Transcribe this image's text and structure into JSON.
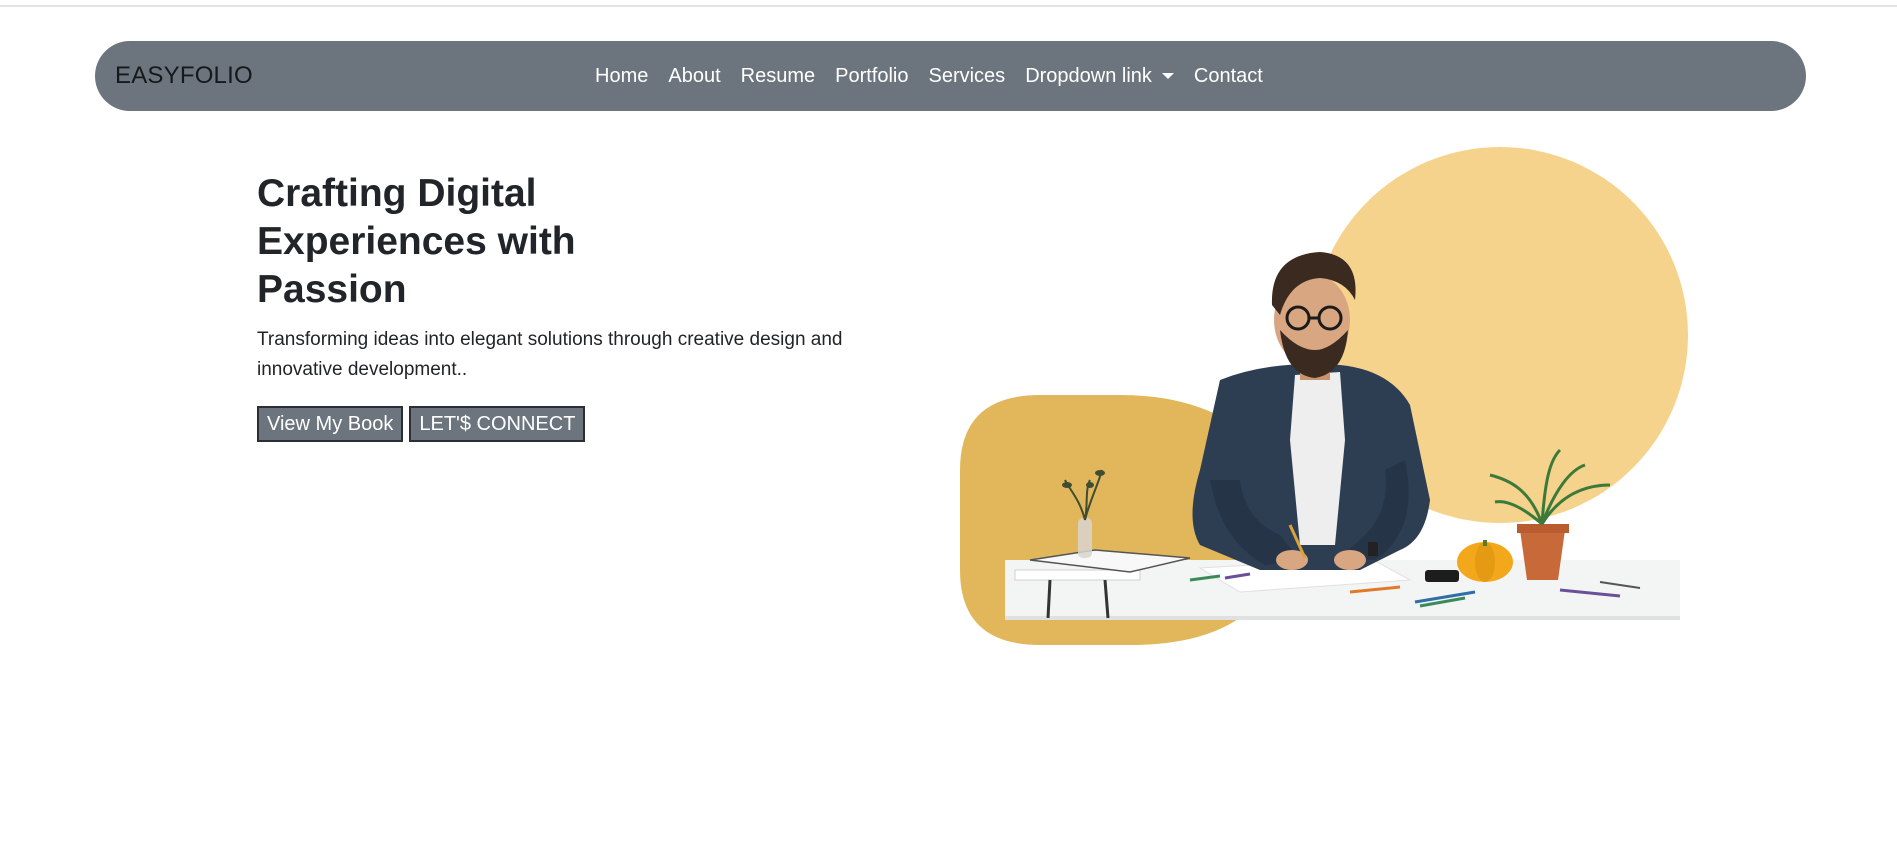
{
  "navbar": {
    "brand": "EASYFOLIO",
    "links": [
      {
        "label": "Home"
      },
      {
        "label": "About"
      },
      {
        "label": "Resume"
      },
      {
        "label": "Portfolio"
      },
      {
        "label": "Services"
      },
      {
        "label": "Dropdown link",
        "has_caret": true
      },
      {
        "label": "Contact"
      }
    ],
    "background": "#6c757d"
  },
  "hero": {
    "title": "Crafting Digital Experiences with Passion",
    "subtitle": "Transforming ideas into elegant solutions through creative design and innovative development..",
    "buttons": [
      {
        "label": "View My Book"
      },
      {
        "label": "LET'$ CONNECT"
      }
    ]
  },
  "colors": {
    "circle_light": "#f5d38c",
    "blob_dark": "#e2b75b",
    "button_bg": "#6c757d"
  },
  "icons": {
    "dropdown": "chevron-down-icon"
  }
}
